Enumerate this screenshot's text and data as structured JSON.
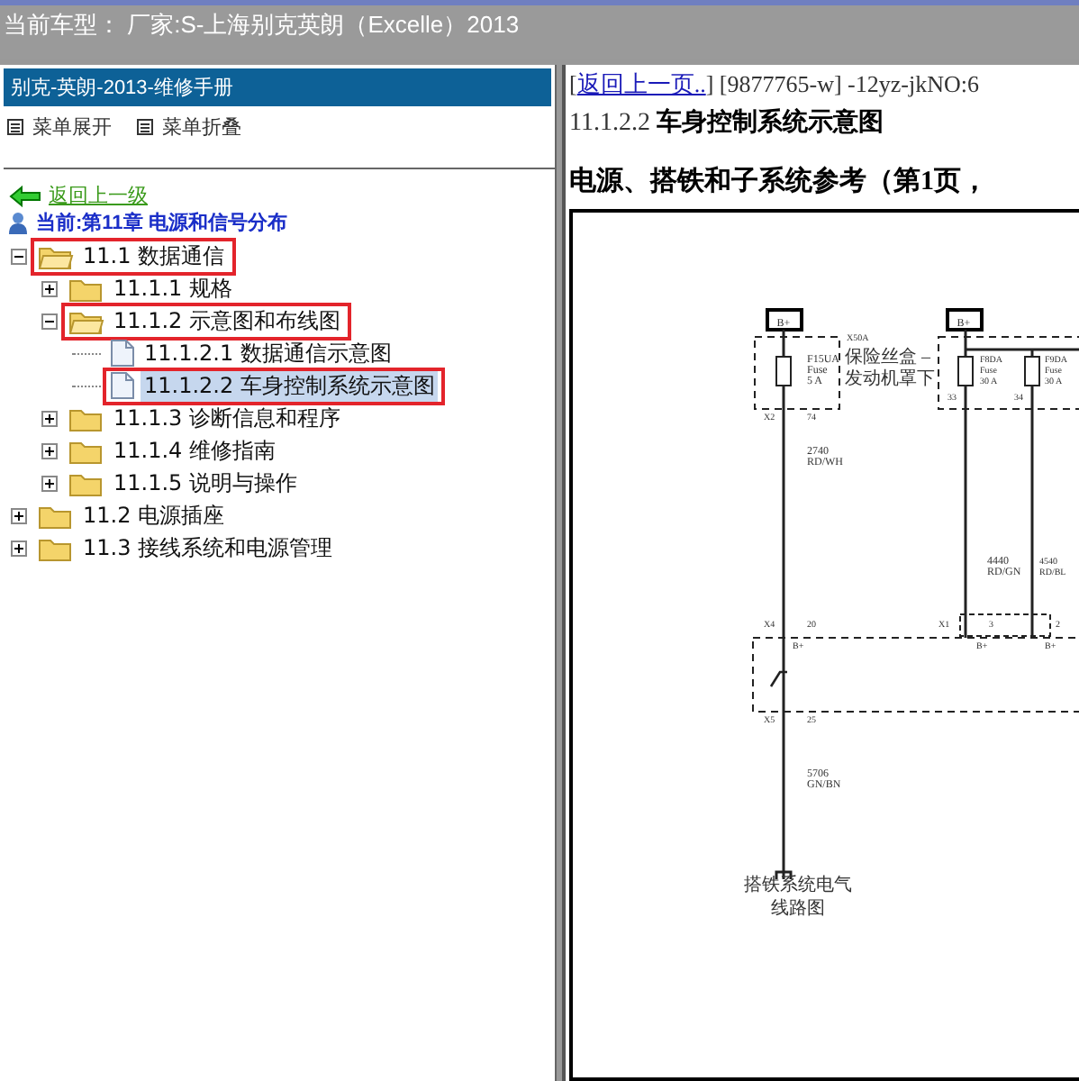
{
  "window": {
    "title": "当前车型： 厂家:S-上海别克英朗（Excelle）2013"
  },
  "sidebar": {
    "title": "别克-英朗-2013-维修手册",
    "menu": [
      {
        "label": "菜单展开"
      },
      {
        "label": "菜单折叠"
      }
    ],
    "back_link": "返回上一级",
    "current": "当前:第11章 电源和信号分布",
    "tree": [
      {
        "label": "11.1 数据通信",
        "kind": "folder",
        "expanded": true,
        "highlighted": true,
        "selected": false,
        "children": [
          {
            "label": "11.1.1 规格",
            "kind": "folder",
            "expanded": false,
            "highlighted": false,
            "selected": false
          },
          {
            "label": "11.1.2 示意图和布线图",
            "kind": "folder",
            "expanded": true,
            "highlighted": true,
            "selected": false,
            "children": [
              {
                "label": "11.1.2.1 数据通信示意图",
                "kind": "page",
                "highlighted": false,
                "selected": false
              },
              {
                "label": "11.1.2.2 车身控制系统示意图",
                "kind": "page",
                "highlighted": true,
                "selected": true
              }
            ]
          },
          {
            "label": "11.1.3 诊断信息和程序",
            "kind": "folder",
            "expanded": false,
            "highlighted": false,
            "selected": false
          },
          {
            "label": "11.1.4 维修指南",
            "kind": "folder",
            "expanded": false,
            "highlighted": false,
            "selected": false
          },
          {
            "label": "11.1.5 说明与操作",
            "kind": "folder",
            "expanded": false,
            "highlighted": false,
            "selected": false
          }
        ]
      },
      {
        "label": "11.2 电源插座",
        "kind": "folder",
        "expanded": false,
        "highlighted": false,
        "selected": false
      },
      {
        "label": "11.3 接线系统和电源管理",
        "kind": "folder",
        "expanded": false,
        "highlighted": false,
        "selected": false
      }
    ]
  },
  "content": {
    "link_before": "[",
    "back_link": "返回上一页..",
    "link_after": "] [9877765-w] -12yz-jkNO:6",
    "section_number": "11.1.2.2",
    "section_title": "车身控制系统示意图",
    "subtitle": "电源、搭铁和子系统参考（第1页，",
    "diagram": {
      "labels": [
        "B+",
        "B+",
        "X50A",
        "保险丝盒 –",
        "发动机罩下",
        "F15UA",
        "Fuse",
        "5 A",
        "X2",
        "74",
        "2740",
        "RD/WH",
        "F8DA",
        "Fuse",
        "30 A",
        "33",
        "F9DA",
        "Fuse",
        "30 A",
        "34",
        "4440",
        "RD/GN",
        "4540",
        "RD/BL",
        "X4",
        "20",
        "B+",
        "X1",
        "3",
        "2",
        "B+",
        "B+",
        "X5",
        "25",
        "5706",
        "GN/BN",
        "搭铁系统电气",
        "线路图"
      ]
    }
  }
}
